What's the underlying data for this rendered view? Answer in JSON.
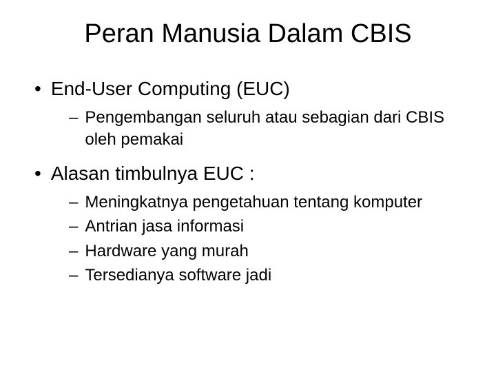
{
  "title": "Peran Manusia Dalam CBIS",
  "sections": [
    {
      "heading": "End-User Computing (EUC)",
      "items": [
        "Pengembangan seluruh atau sebagian dari CBIS oleh pemakai"
      ]
    },
    {
      "heading": "Alasan timbulnya EUC :",
      "items": [
        "Meningkatnya pengetahuan tentang komputer",
        "Antrian jasa informasi",
        "Hardware yang murah",
        "Tersedianya software jadi"
      ]
    }
  ]
}
